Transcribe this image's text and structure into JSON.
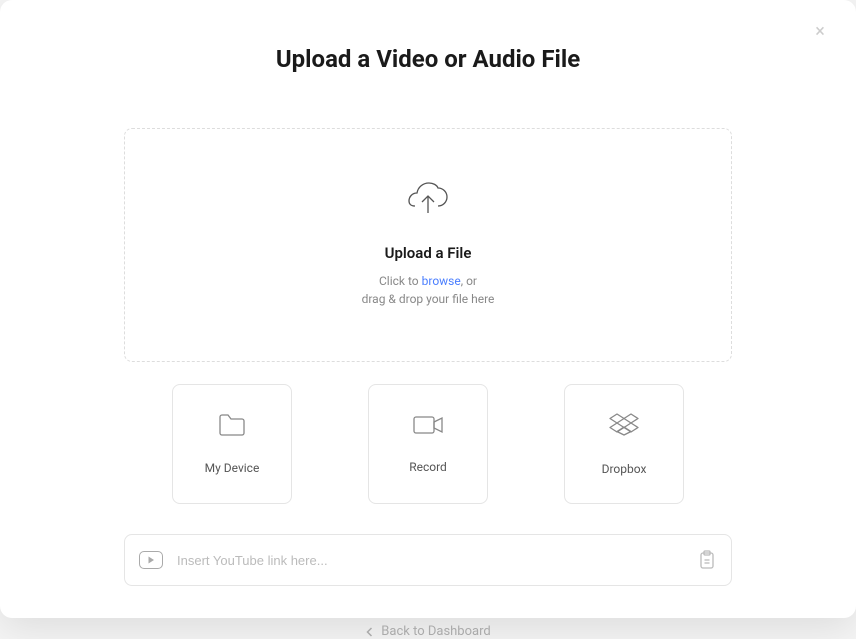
{
  "modal": {
    "title": "Upload a Video or Audio File",
    "close_label": "×"
  },
  "dropzone": {
    "title": "Upload a File",
    "text_prefix": "Click to ",
    "browse_label": "browse",
    "text_suffix": ", or",
    "text_line2": "drag & drop your file here"
  },
  "options": [
    {
      "label": "My Device",
      "icon": "folder"
    },
    {
      "label": "Record",
      "icon": "camera"
    },
    {
      "label": "Dropbox",
      "icon": "dropbox"
    }
  ],
  "url_input": {
    "placeholder": "Insert YouTube link here..."
  },
  "back_link": {
    "label": "Back to Dashboard"
  }
}
